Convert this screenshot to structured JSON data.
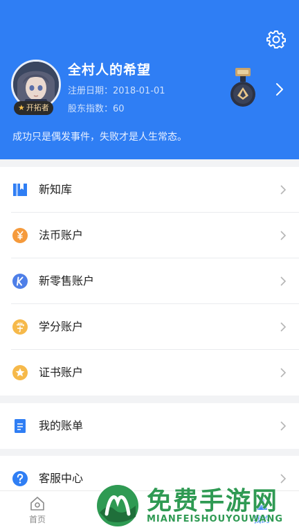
{
  "profile": {
    "name": "全村人的希望",
    "pioneer_badge": "开拓者",
    "register_date": "注册日期：2018-01-01",
    "shareholder_index": "股东指数：60",
    "motto": "成功只是偶发事件，失败才是人生常态。"
  },
  "menu": {
    "section1": [
      {
        "label": "新知库",
        "icon": "book-icon"
      },
      {
        "label": "法币账户",
        "icon": "yen-icon"
      },
      {
        "label": "新零售账户",
        "icon": "k-icon"
      },
      {
        "label": "学分账户",
        "icon": "xue-icon"
      },
      {
        "label": "证书账户",
        "icon": "star-icon"
      }
    ],
    "section2": [
      {
        "label": "我的账单",
        "icon": "bill-icon"
      }
    ],
    "section3": [
      {
        "label": "客服中心",
        "icon": "help-icon"
      }
    ]
  },
  "bottom_nav": {
    "home": "首页",
    "tab2": "",
    "tab3": "",
    "mine": "我的"
  },
  "watermark": {
    "title": "免费手游网",
    "subtitle": "MIANFEISHOUYOUWANG"
  },
  "colors": {
    "header_bg": "#2f7ef4",
    "orange": "#f59a3c",
    "blue_k": "#4e7fe8",
    "yellow": "#f6b94a",
    "watermark_green": "#2f9a53"
  }
}
